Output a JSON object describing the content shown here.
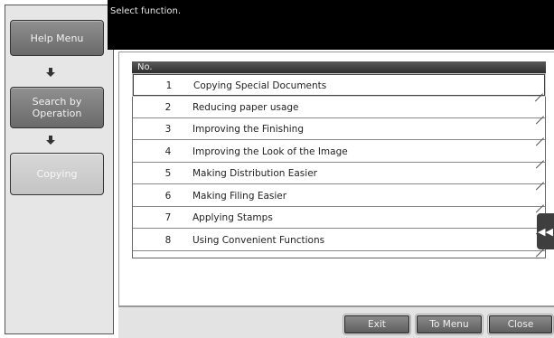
{
  "message": "Select function.",
  "left_nav": {
    "help_menu": "Help Menu",
    "search_by_operation": "Search by Operation",
    "copying": "Copying"
  },
  "list": {
    "header": "No.",
    "items": [
      {
        "num": "1",
        "label": "Copying Special Documents"
      },
      {
        "num": "2",
        "label": "Reducing paper usage"
      },
      {
        "num": "3",
        "label": "Improving the Finishing"
      },
      {
        "num": "4",
        "label": "Improving the Look of the Image"
      },
      {
        "num": "5",
        "label": "Making Distribution Easier"
      },
      {
        "num": "6",
        "label": "Making Filing Easier"
      },
      {
        "num": "7",
        "label": "Applying Stamps"
      },
      {
        "num": "8",
        "label": "Using Convenient Functions"
      }
    ],
    "selected_index": 0
  },
  "bottom": {
    "exit": "Exit",
    "to_menu": "To Menu",
    "close": "Close"
  },
  "side_tab_icon": "double-left-arrow-icon"
}
